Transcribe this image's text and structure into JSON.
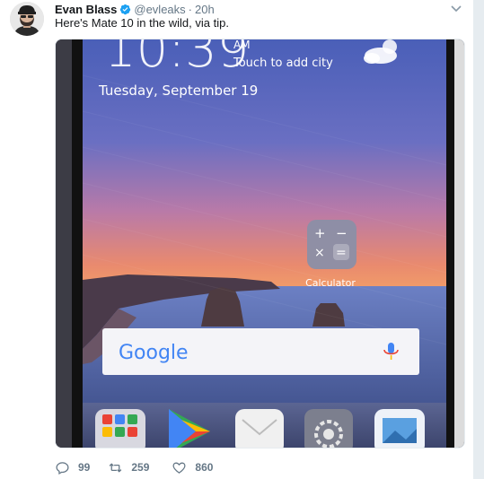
{
  "tweet": {
    "author_name": "Evan Blass",
    "handle": "@evleaks",
    "separator": "·",
    "time": "20h",
    "text": "Here's Mate 10 in the wild, via tip."
  },
  "phone": {
    "clock": "10:39",
    "am_pm": "AM",
    "add_city": "Touch to add city",
    "date": "Tuesday, September 19",
    "calculator_label": "Calculator",
    "search_logo": "Google"
  },
  "actions": {
    "replies": "99",
    "retweets": "259",
    "likes": "860"
  },
  "colors": {
    "accent": "#1da1f2",
    "muted": "#657786",
    "text": "#14171a"
  },
  "icons": [
    "verified-icon",
    "caret-down-icon",
    "reply-icon",
    "retweet-icon",
    "like-icon",
    "weather-icon",
    "microphone-icon"
  ]
}
